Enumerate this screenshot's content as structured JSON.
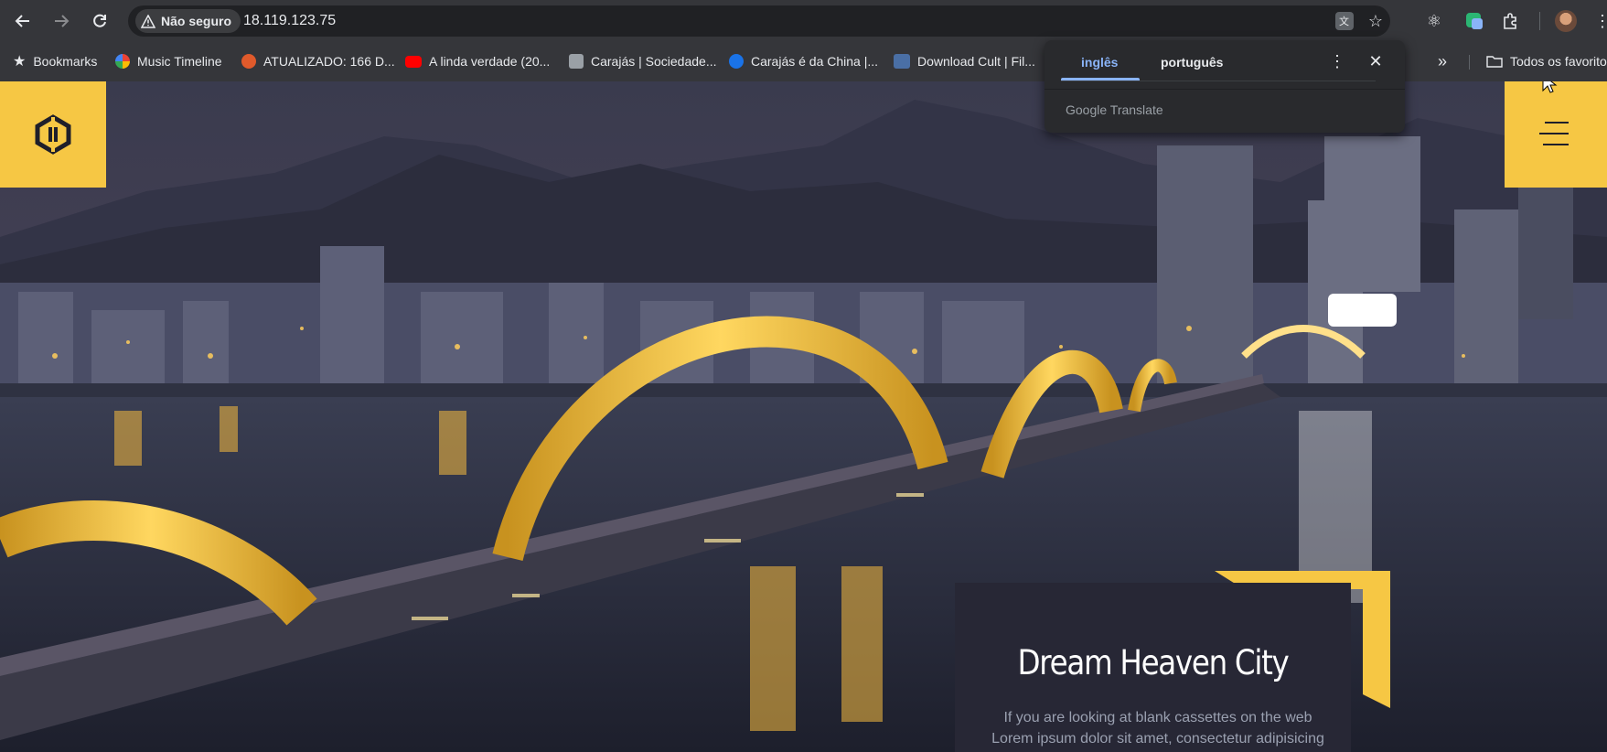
{
  "browser": {
    "security_label": "Não seguro",
    "url": "18.119.123.75"
  },
  "bookmarks": {
    "items": [
      {
        "label": "Bookmarks",
        "icon": "star-icon"
      },
      {
        "label": "Music Timeline",
        "icon": "google-favicon"
      },
      {
        "label": "ATUALIZADO: 166 D...",
        "icon": "site-favicon"
      },
      {
        "label": "A linda verdade (20...",
        "icon": "youtube-favicon"
      },
      {
        "label": "Carajás | Sociedade...",
        "icon": "site-favicon"
      },
      {
        "label": "Carajás é da China |...",
        "icon": "site-favicon"
      },
      {
        "label": "Download Cult | Fil...",
        "icon": "site-favicon"
      }
    ],
    "more_label": "»",
    "all_favorites_label": "Todos os favoritos"
  },
  "translate_popup": {
    "tabs": [
      "inglês",
      "português"
    ],
    "active_tab": "inglês",
    "footer": "Google Translate"
  },
  "page": {
    "card_title": "Dream Heaven City",
    "card_text": "If you are looking at blank cassettes on the web Lorem ipsum dolor sit amet, consectetur adipisicing eiusmod",
    "accent_color": "#f6c744"
  }
}
